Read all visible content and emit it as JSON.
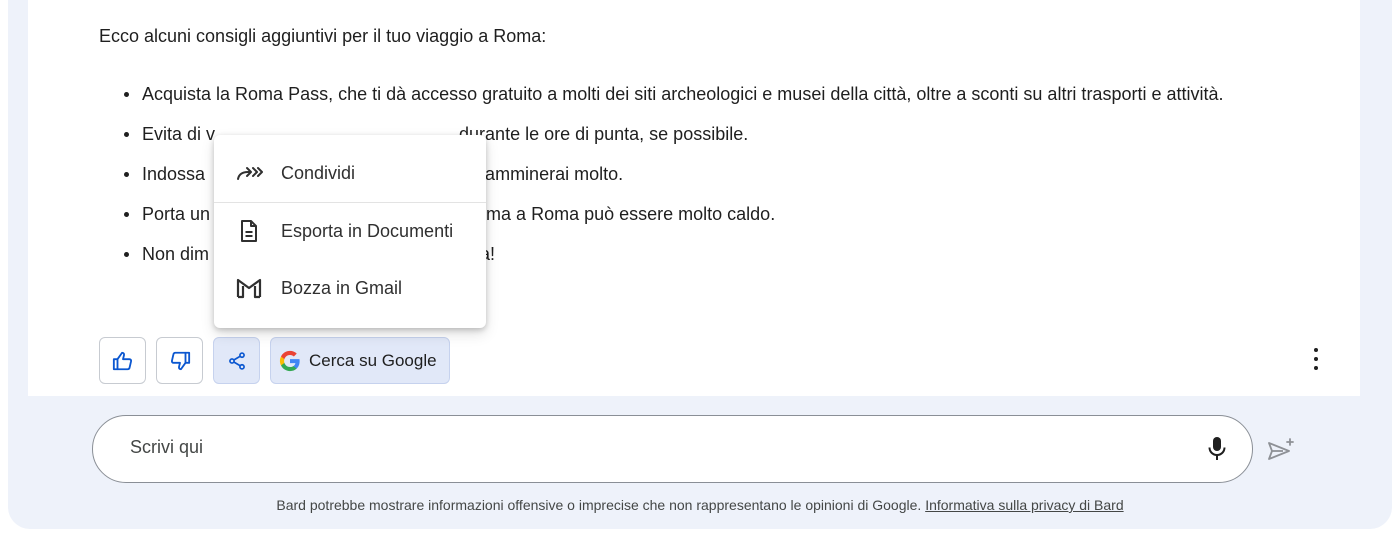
{
  "response": {
    "intro": "Ecco alcuni consigli aggiuntivi per il tuo viaggio a Roma:",
    "bullets": [
      "Acquista la Roma Pass, che ti dà accesso gratuito a molti dei siti archeologici e musei della città, oltre a sconti su altri trasporti e attività.",
      "Evita di v",
      "durante le ore di punta, se possibile.",
      "Indossa",
      "a camminerai molto.",
      "Porta un",
      "ma a Roma può essere molto caldo.",
      "Non dim",
      "a!"
    ]
  },
  "share_menu": {
    "items": [
      {
        "label": "Condividi",
        "icon": "share-arrow-icon"
      },
      {
        "label": "Esporta in Documenti",
        "icon": "document-icon"
      },
      {
        "label": "Bozza in Gmail",
        "icon": "gmail-icon"
      }
    ]
  },
  "actions": {
    "thumbs_up_icon": "thumbs-up-icon",
    "thumbs_down_icon": "thumbs-down-icon",
    "share_icon": "share-icon",
    "google_button_label": "Cerca su Google",
    "more_icon": "more-vert-icon"
  },
  "input": {
    "placeholder": "Scrivi qui",
    "mic_icon": "mic-icon",
    "send_icon": "send-icon"
  },
  "footer": {
    "disclaimer": "Bard potrebbe mostrare informazioni offensive o imprecise che non rappresentano le opinioni di Google.",
    "privacy_link": "Informativa sulla privacy di Bard"
  },
  "colors": {
    "page_background": "#eef2fa",
    "active_button": "#e1e8f8",
    "icon_blue": "#0b57d0"
  }
}
